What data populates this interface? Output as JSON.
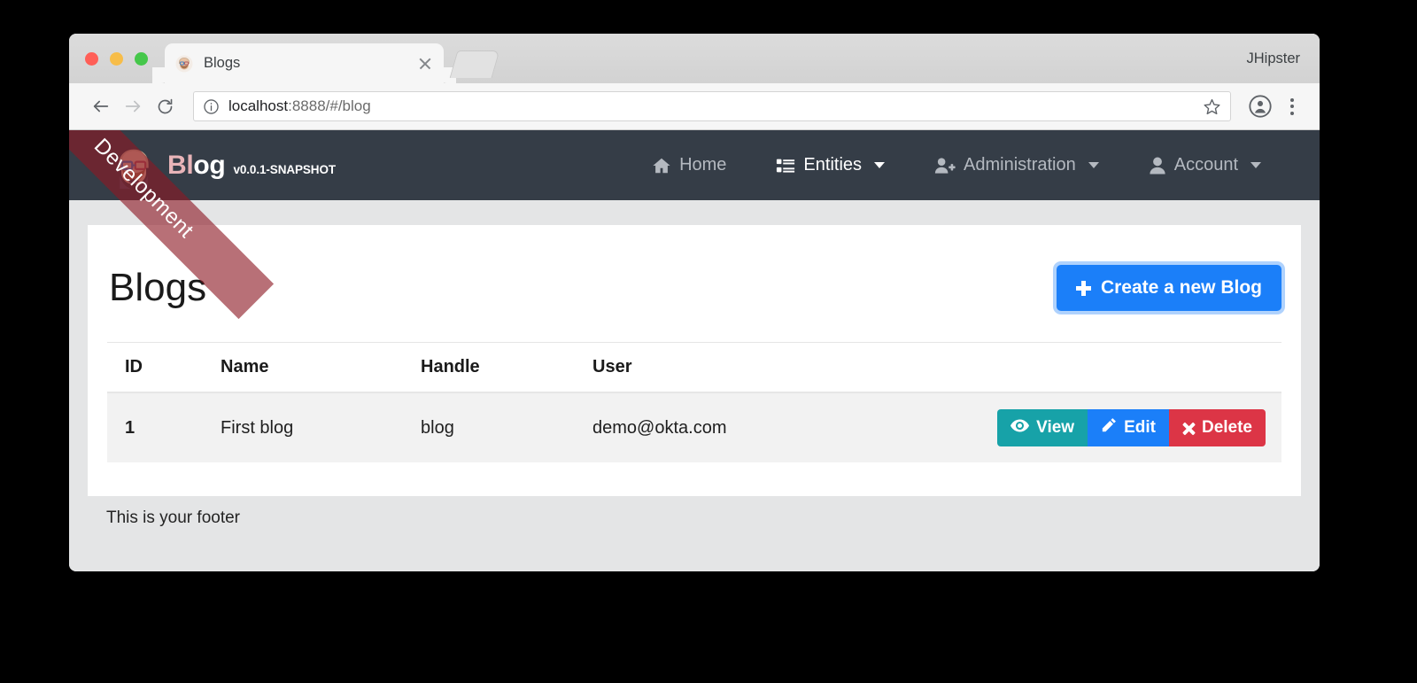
{
  "browser": {
    "tab": {
      "title": "Blogs",
      "favicon": "jhipster-mascot-favicon"
    },
    "window_user": "JHipster",
    "url_host": "localhost",
    "url_path": ":8888/#/blog",
    "back_icon": "back-arrow-icon",
    "forward_icon": "forward-arrow-icon",
    "reload_icon": "reload-icon",
    "info_icon": "site-info-icon",
    "star_icon": "bookmark-star-icon",
    "profile_icon": "profile-avatar-icon",
    "menu_icon": "three-dot-menu-icon",
    "new_tab_icon": "new-tab-button"
  },
  "ribbon": {
    "label": "Development"
  },
  "navbar": {
    "brand": {
      "prefix": "Bl",
      "suffix": "og",
      "version": "v0.0.1-SNAPSHOT",
      "logo": "jhipster-mascot-logo"
    },
    "items": [
      {
        "label": "Home",
        "icon": "home-icon",
        "active": false,
        "caret": false
      },
      {
        "label": "Entities",
        "icon": "list-icon",
        "active": true,
        "caret": true
      },
      {
        "label": "Administration",
        "icon": "user-plus-icon",
        "active": false,
        "caret": true
      },
      {
        "label": "Account",
        "icon": "user-icon",
        "active": false,
        "caret": true
      }
    ]
  },
  "main": {
    "page_title": "Blogs",
    "create_button": "Create a new Blog",
    "create_button_icon": "plus-icon",
    "table": {
      "headers": [
        "ID",
        "Name",
        "Handle",
        "User"
      ],
      "rows": [
        {
          "id": "1",
          "name": "First blog",
          "handle": "blog",
          "user": "demo@okta.com"
        }
      ],
      "actions": [
        {
          "label": "View",
          "icon": "eye-icon",
          "color": "#17a2a8"
        },
        {
          "label": "Edit",
          "icon": "pencil-icon",
          "color": "#1b7ff9"
        },
        {
          "label": "Delete",
          "icon": "x-icon",
          "color": "#dc3546"
        }
      ]
    }
  },
  "footer": {
    "text": "This is your footer"
  },
  "colors": {
    "navbar_bg": "#353d47",
    "body_bg": "#e4e5e6",
    "primary": "#1b7ff9",
    "brand_pink": "#e8b4b8",
    "ribbon": "#8c1923"
  }
}
